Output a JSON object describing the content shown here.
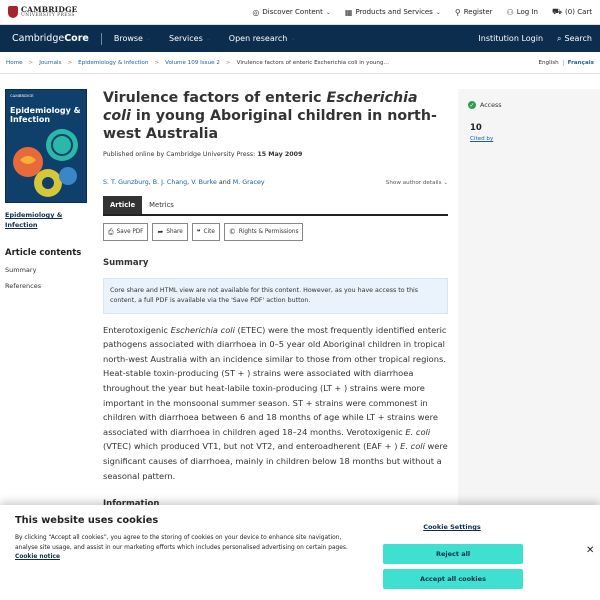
{
  "topbar": {
    "logo_line1": "CAMBRIDGE",
    "logo_line2": "UNIVERSITY PRESS",
    "items": [
      {
        "label": "Discover Content",
        "icon": "compass-icon"
      },
      {
        "label": "Products and Services",
        "icon": "grid-icon"
      },
      {
        "label": "Register",
        "icon": "add-user-icon"
      },
      {
        "label": "Log In",
        "icon": "user-icon"
      },
      {
        "label": "(0) Cart",
        "icon": "cart-icon"
      }
    ]
  },
  "mainnav": {
    "brand_light": "Cambridge",
    "brand_bold": "Core",
    "items": [
      "Browse",
      "Services",
      "Open research"
    ],
    "institution": "Institution Login",
    "search": "Search"
  },
  "breadcrumb": {
    "items": [
      "Home",
      "Journals",
      "Epidemiology & Infection",
      "Volume 109 Issue 2"
    ],
    "current": "Virulence factors of enteric Escherichia coli in young...",
    "lang_en": "English",
    "lang_fr": "Français"
  },
  "sidebar": {
    "cover_publisher": "CAMBRIDGE",
    "cover_title_1": "Epidemiology &",
    "cover_title_2": "Infection",
    "journal_link_1": "Epidemiology &",
    "journal_link_2": "Infection",
    "contents_title": "Article contents",
    "contents_items": [
      "Summary",
      "References"
    ]
  },
  "article": {
    "title_pre": "Virulence factors of enteric ",
    "title_italic": "Escherichia coli",
    "title_post": " in young Aboriginal children in north-west Australia",
    "published_label": "Published online by Cambridge University Press: ",
    "published_date": "15 May 2009",
    "authors": [
      "S. T. Gunzburg",
      "B. J. Chang",
      "V. Burke",
      "M. Gracey"
    ],
    "author_and": "and",
    "show_author_details": "Show author details",
    "tabs": [
      "Article",
      "Metrics"
    ],
    "actions": [
      {
        "label": "Save PDF",
        "icon": "pdf-icon"
      },
      {
        "label": "Share",
        "icon": "share-icon"
      },
      {
        "label": "Cite",
        "icon": "quote-icon"
      },
      {
        "label": "Rights & Permissions",
        "icon": "copyright-icon"
      }
    ],
    "summary_heading": "Summary",
    "notice": "Core share and HTML view are not available for this content. However, as you have access to this content, a full PDF is available via the 'Save PDF' action button.",
    "abstract": {
      "p1": "Enterotoxigenic ",
      "i1": "Escherichia coli",
      "p2": " (ETEC) were the most frequently identified enteric pathogens associated with diarrhoea in 0–5 year old Aboriginal children in tropical north-west Australia with an incidence similar to those from other tropical regions. Heat-stable toxin-producing (ST + ) strains were associated with diarrhoea throughout the year but heat-labile toxin-producing (LT + ) strains were more important in the monsoonal summer season. ST + strains were commonest in children with diarrhoea between 6 and 18 months of age while LT + strains were associated with diarrhoea in children aged 18–24 months. Verotoxigenic ",
      "i2": "E. coli",
      "p3": " (VTEC) which produced VT1, but not VT2, and enteroadherent (EAF + ) ",
      "i3": "E. coli",
      "p4": " were significant causes of diarrhoea, mainly in children below 18 months but without a seasonal pattern."
    },
    "info_heading": "Information"
  },
  "rightpanel": {
    "access": "Access",
    "cited_count": "10",
    "cited_label": "Cited by"
  },
  "cookie": {
    "title": "This website uses cookies",
    "text": "By clicking “Accept all cookies”, you agree to the storing of cookies on your device to enhance site navigation, analyse site usage, and assist in our marketing efforts which includes personalised advertising on certain pages. ",
    "link": "Cookie notice",
    "settings": "Cookie Settings",
    "reject": "Reject all",
    "accept": "Accept all cookies"
  },
  "colors": {
    "navy": "#0d2d4f",
    "link": "#1b5fa7",
    "cookie_button": "#3fe0cf",
    "access_green": "#2e9f4a"
  }
}
